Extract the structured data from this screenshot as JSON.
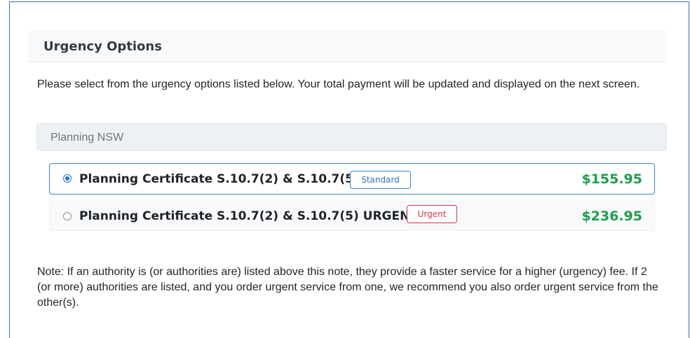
{
  "section": {
    "title": "Urgency Options",
    "intro": "Please select from the urgency options listed below. Your total payment will be updated and displayed on the next screen."
  },
  "authority": {
    "name": "Planning NSW"
  },
  "options": [
    {
      "label": "Planning Certificate S.10.7(2) & S.10.7(5)",
      "badge": "Standard",
      "price": "$155.95",
      "selected": true
    },
    {
      "label": "Planning Certificate S.10.7(2) & S.10.7(5) URGENT",
      "badge": "Urgent",
      "price": "$236.95",
      "selected": false
    }
  ],
  "note": "Note: If an authority is (or authorities are) listed above this note, they provide a faster service for a higher (urgency) fee. If 2 (or more) authorities are listed, and you order urgent service from one, we recommend you also order urgent service from the other(s).",
  "colors": {
    "frame_border": "#3d6fb0",
    "selected_border": "#3b82d6",
    "price": "#1e9e4a",
    "urgent_badge": "#dc3545",
    "standard_badge": "#2f73c9"
  }
}
